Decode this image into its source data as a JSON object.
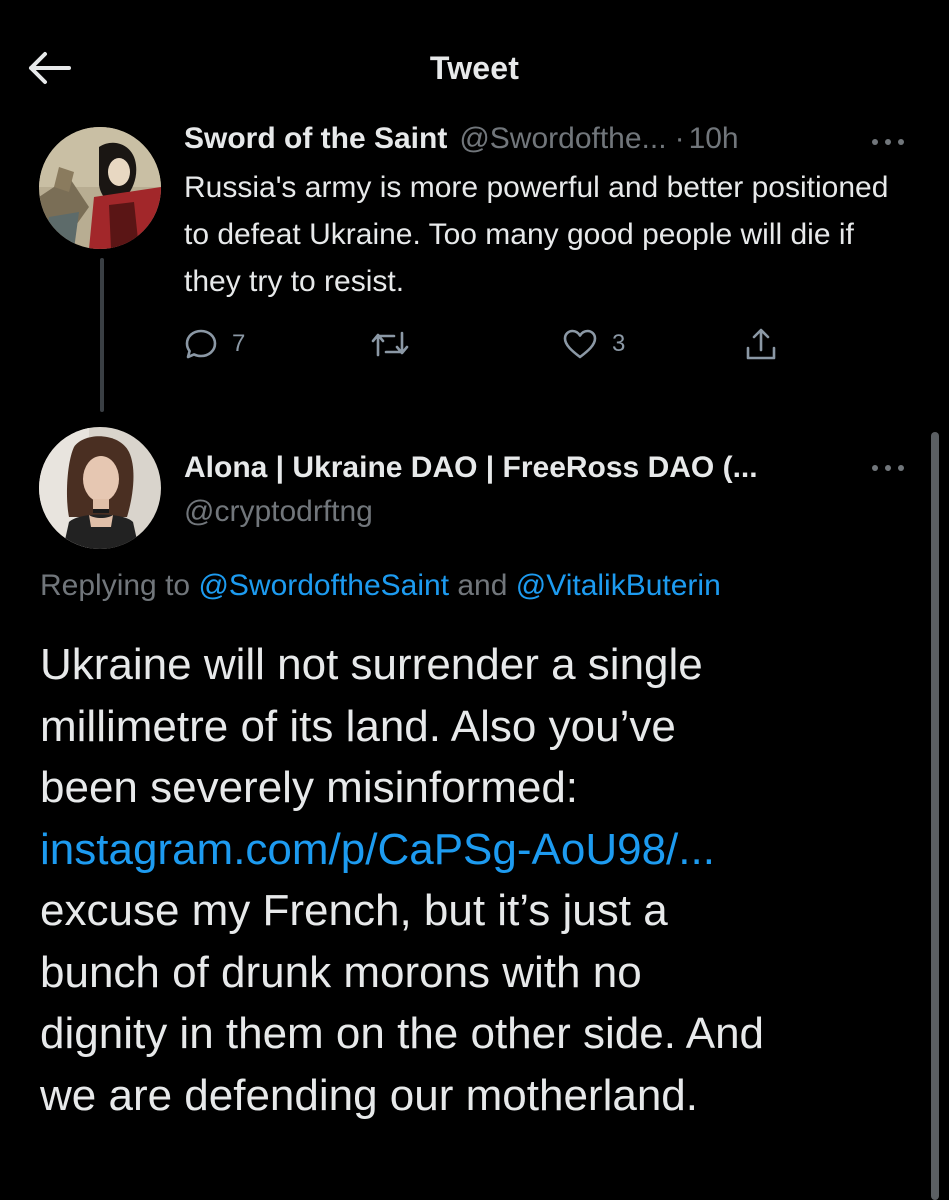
{
  "header": {
    "title": "Tweet",
    "back_icon": "arrow-left-icon"
  },
  "colors": {
    "background": "#000000",
    "text": "#e7e9ea",
    "secondary": "#71767b",
    "link": "#1d9bf0"
  },
  "original_tweet": {
    "name": "Sword of the Saint",
    "handle": "@Swordofthe...",
    "separator": "·",
    "time": "10h",
    "text": "Russia's army is more powerful and better positioned to defeat Ukraine. Too many good people will die if they try to resist.",
    "replies": "7",
    "likes": "3"
  },
  "reply_tweet": {
    "name": "Alona | Ukraine DAO | FreeRoss DAO (...",
    "handle": "@cryptodrftng",
    "replying_prefix": "Replying to ",
    "replying_mention_1": "@SwordoftheSaint",
    "replying_and": " and ",
    "replying_mention_2": "@VitalikButerin",
    "lines": [
      "Ukraine will not surrender a single",
      "millimetre of its land. Also you’ve",
      "been severely misinformed:",
      "instagram.com/p/CaPSg-AoU98/...",
      "excuse my French, but it’s just a",
      "bunch of drunk morons with no",
      "dignity in them on the other side. And",
      "we are defending our motherland."
    ]
  }
}
